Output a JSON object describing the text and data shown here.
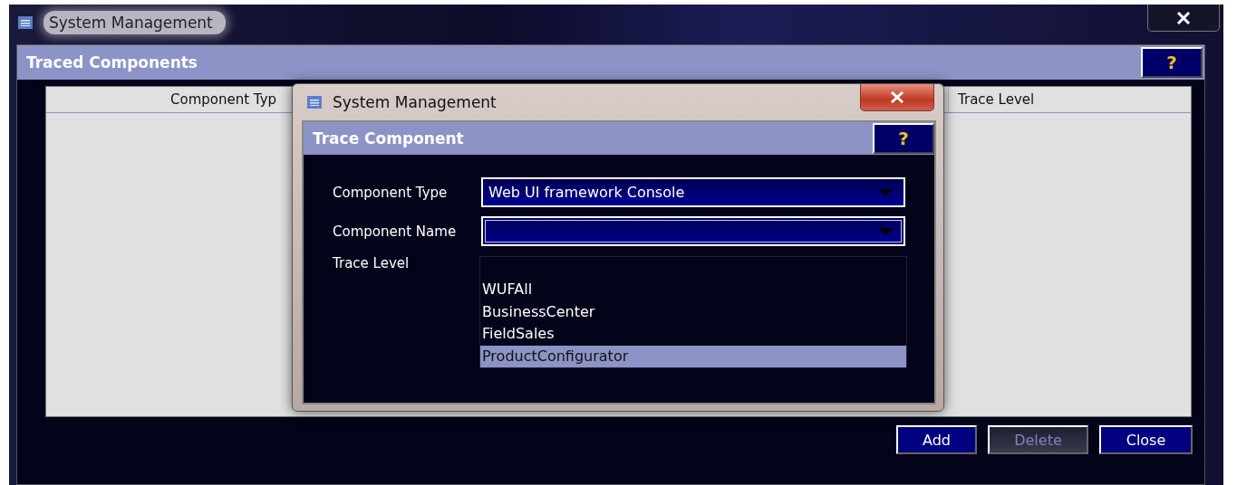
{
  "main_window": {
    "title": "System Management",
    "panel_title": "Traced Components",
    "help": "?",
    "table": {
      "columns": [
        "Component Typ",
        "Trace Level"
      ]
    },
    "buttons": [
      {
        "label": "Add",
        "disabled": false
      },
      {
        "label": "Delete",
        "disabled": true
      },
      {
        "label": "Close",
        "disabled": false
      }
    ]
  },
  "dialog": {
    "title": "System Management",
    "panel_title": "Trace Component",
    "help": "?",
    "fields": [
      {
        "kind": "select",
        "label": "Component Type",
        "value": "Web UI framework Console",
        "focused": false
      },
      {
        "kind": "select",
        "label": "Component Name",
        "focused": true
      },
      {
        "kind": "label",
        "label": "Trace Level"
      }
    ],
    "dropdown_options": [
      {
        "label": "WUFAll",
        "selected": false
      },
      {
        "label": "BusinessCenter",
        "selected": false
      },
      {
        "label": "FieldSales",
        "selected": false
      },
      {
        "label": "ProductConfigurator",
        "selected": true
      }
    ]
  }
}
